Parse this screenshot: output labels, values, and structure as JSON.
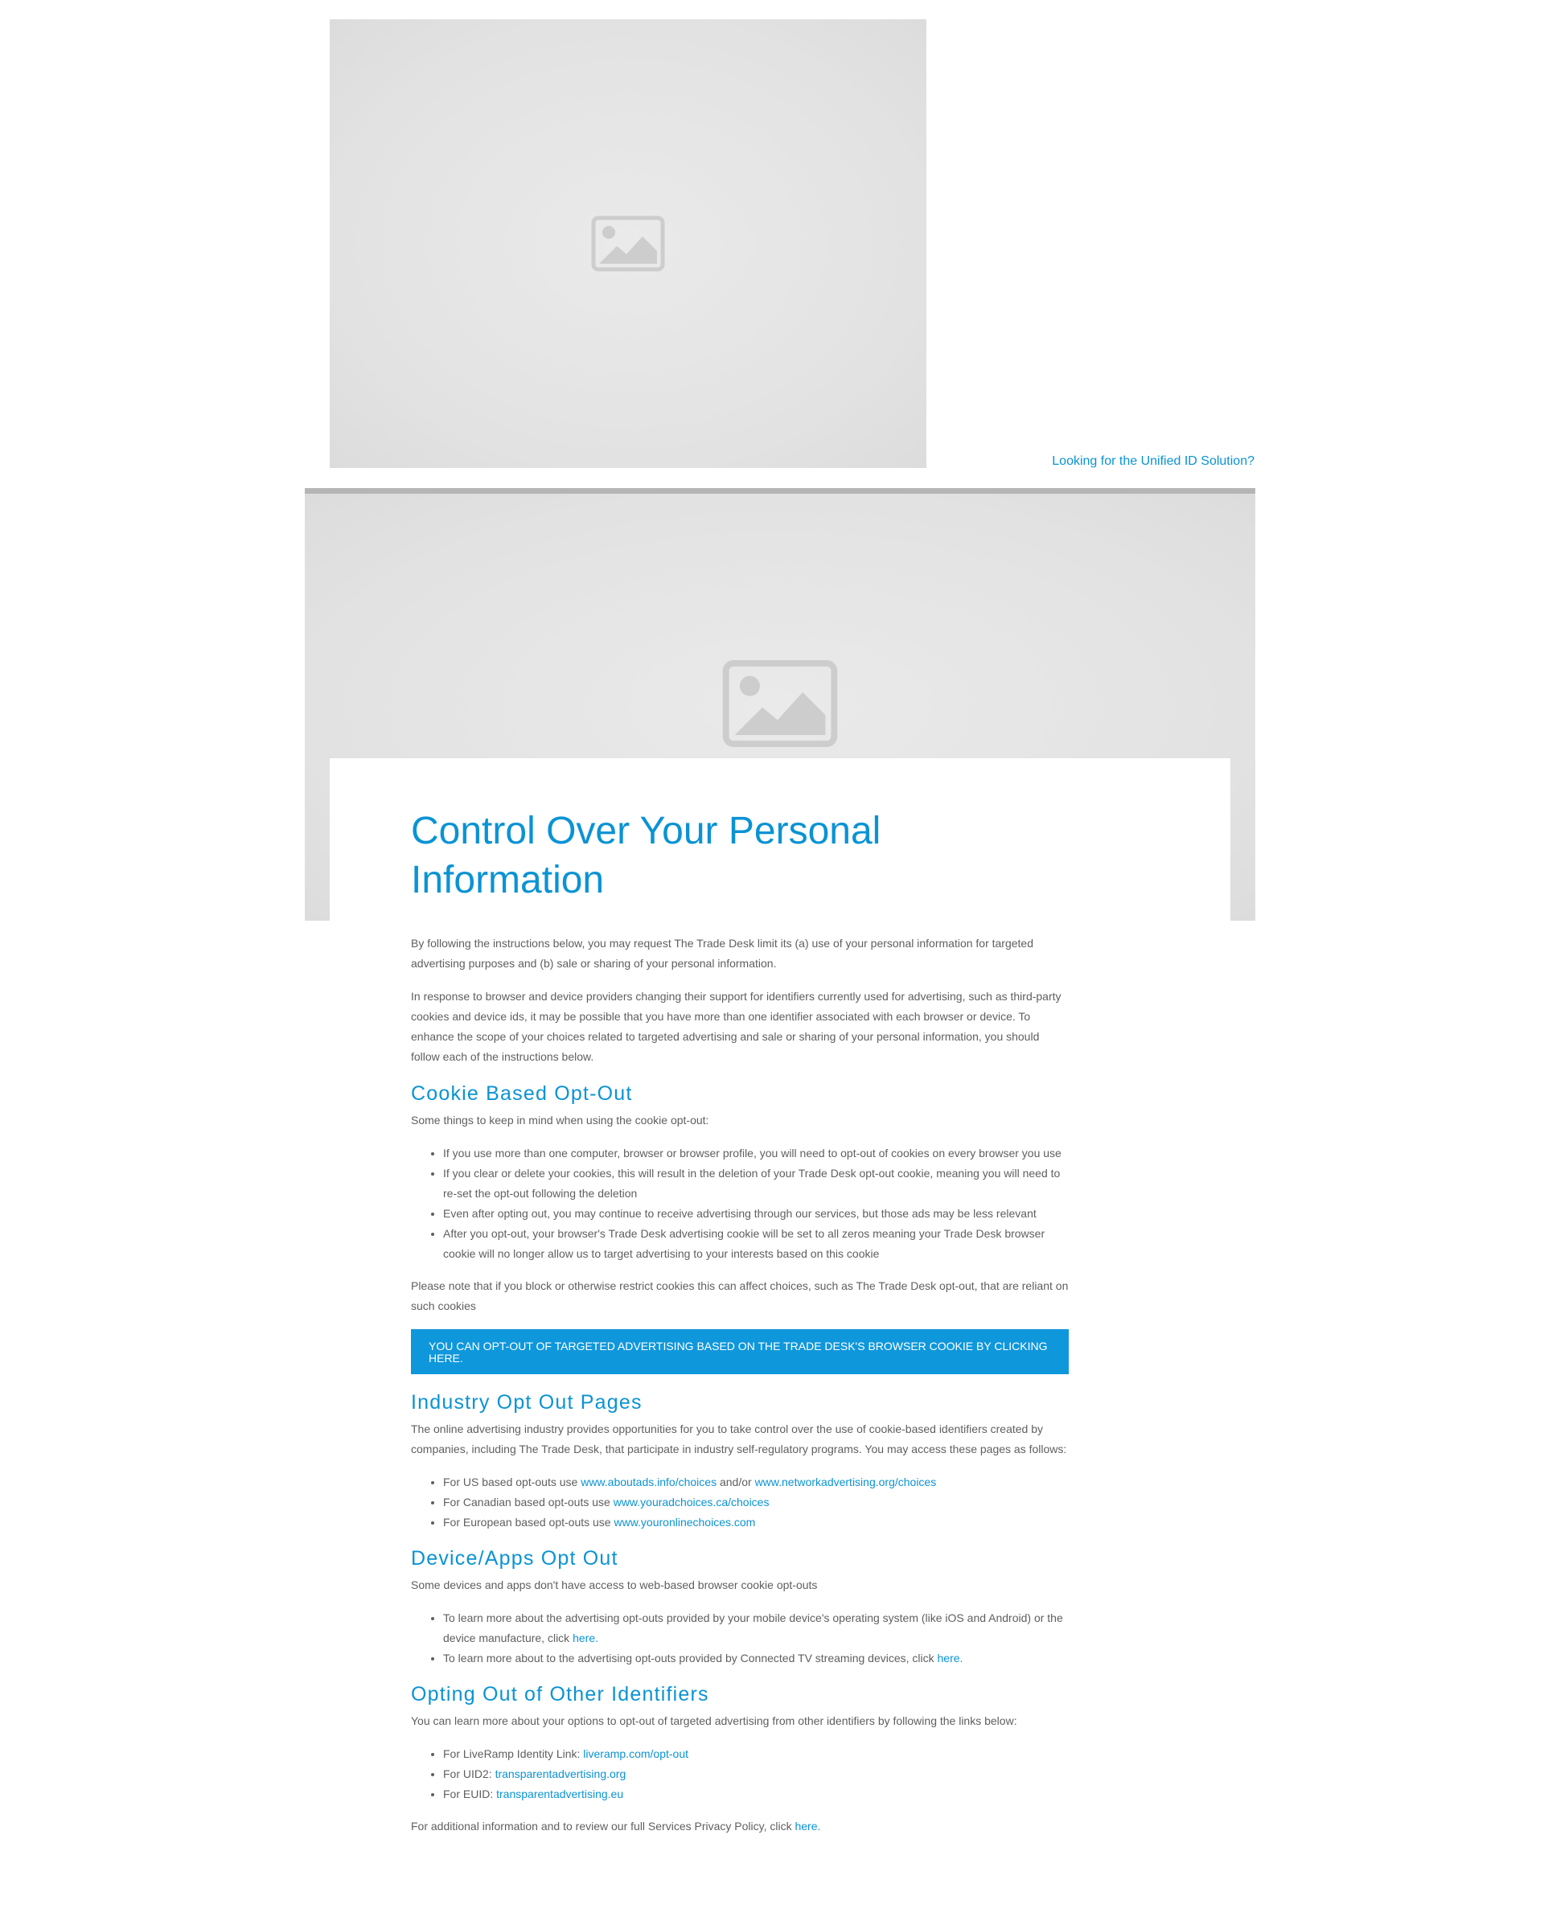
{
  "header": {
    "unified_link": "Looking for the Unified ID Solution?"
  },
  "icons": {
    "image_placeholder": "image-placeholder-icon"
  },
  "page": {
    "title": "Control Over Your Personal Information",
    "intro_1": "By following the instructions below, you may request The Trade Desk limit its (a) use of your personal information for targeted advertising purposes and (b) sale or sharing of your personal information.",
    "intro_2": "In response to browser and device providers changing their support for identifiers currently used for advertising, such as third-party cookies and device ids, it may be possible that you have more than one identifier associated with each browser or device. To enhance the scope of your choices related to targeted advertising and sale or sharing of your personal information, you should follow each of the instructions below."
  },
  "cookie": {
    "heading": "Cookie Based Opt-Out",
    "lead": "Some things to keep in mind when using the cookie opt-out:",
    "items": [
      "If you use more than one computer, browser or browser profile, you will need to opt-out of cookies on every browser you use",
      "If you clear or delete your cookies, this will result in the deletion of your Trade Desk opt-out cookie, meaning you will need to re-set the opt-out following the deletion",
      "Even after opting out, you may continue to receive advertising through our services, but those ads may be less relevant",
      "After you opt-out, your browser's Trade Desk advertising cookie will be set to all zeros meaning your Trade Desk browser cookie will no longer allow us to target advertising to your interests based on this cookie"
    ],
    "note": "Please note that if you block or otherwise restrict cookies this can affect choices, such as The Trade Desk opt-out, that are reliant on such cookies",
    "button": "YOU CAN OPT-OUT OF TARGETED ADVERTISING BASED ON THE TRADE DESK'S BROWSER COOKIE BY CLICKING HERE."
  },
  "industry": {
    "heading": "Industry Opt Out Pages",
    "lead": "The online advertising industry provides opportunities for you to take control over the use of cookie-based identifiers created by companies, including The Trade Desk, that participate in industry self-regulatory programs. You may access these pages as follows:",
    "us_prefix": "For US based opt-outs use ",
    "us_link_1": "www.aboutads.info/choices",
    "us_mid": " and/or ",
    "us_link_2": "www.networkadvertising.org/choices",
    "ca_prefix": "For Canadian based opt-outs use ",
    "ca_link": "www.youradchoices.ca/choices",
    "eu_prefix": "For European based opt-outs use ",
    "eu_link": "www.youronlinechoices.com"
  },
  "device": {
    "heading": "Device/Apps Opt Out",
    "lead": "Some devices and apps don't have access to web-based browser cookie opt-outs",
    "item_1_prefix": "To learn more about the advertising opt-outs provided by your mobile device's operating system (like iOS and Android) or the device manufacture, click ",
    "item_1_link": "here.",
    "item_2_prefix": "To learn more about to the advertising opt-outs provided by Connected TV streaming devices, click ",
    "item_2_link": "here."
  },
  "other": {
    "heading": "Opting Out of Other Identifiers",
    "lead": "You can learn more about your options to opt-out of targeted advertising from other identifiers by following the links below:",
    "liveramp_prefix": "For LiveRamp Identity Link: ",
    "liveramp_link": "liveramp.com/opt-out",
    "uid2_prefix": "For UID2: ",
    "uid2_link": "transparentadvertising.org",
    "euid_prefix": "For EUID: ",
    "euid_link": "transparentadvertising.eu"
  },
  "footer": {
    "prefix": "For additional information and to review our full Services Privacy Policy, click ",
    "link": "here."
  },
  "colors": {
    "accent": "#0a93d4",
    "button": "#0f97dc",
    "body_text": "#5f5f5f",
    "placeholder": "#e2e2e2"
  }
}
